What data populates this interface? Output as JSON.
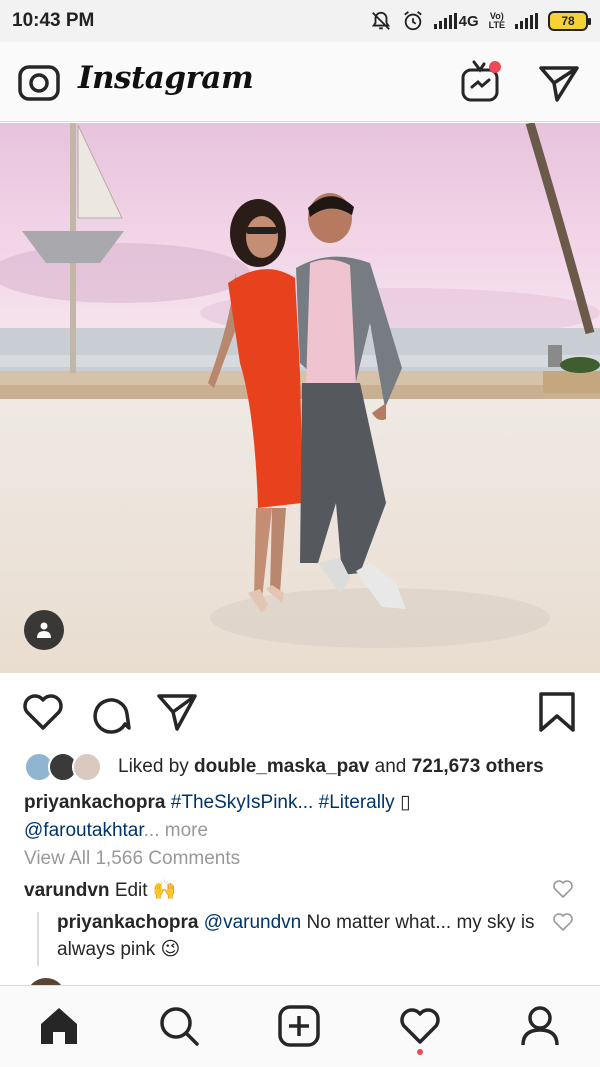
{
  "status_bar": {
    "time": "10:43 PM",
    "network": "4G",
    "volte_top": "Vo)",
    "volte_bottom": "LTE",
    "battery": "78"
  },
  "header": {
    "logo_text": "Instagram",
    "camera_icon": "camera-icon",
    "igtv_icon": "igtv-icon",
    "direct_icon": "direct-message-icon"
  },
  "post": {
    "likes_prefix": "Liked by ",
    "liked_by_user": "double_maska_pav",
    "likes_and": " and ",
    "likes_count": "721,673 others",
    "caption_user": "priyankachopra",
    "caption_hashtag1": "#TheSkyIsPink...",
    "caption_hashtag2": "#Literally",
    "caption_glyph": "▯",
    "caption_mention": "@faroutakhtar",
    "caption_ellipsis": "...",
    "caption_more": "more",
    "view_all_comments": "View All 1,566 Comments",
    "comments": [
      {
        "user": "varundvn",
        "text": "Edit 🙌"
      },
      {
        "user": "priyankachopra",
        "mention": "@varundvn",
        "text": " No matter what... my sky is always pink 😉"
      }
    ]
  },
  "bottom_nav": {
    "items": [
      "home-icon",
      "search-icon",
      "new-post-icon",
      "activity-icon",
      "profile-icon"
    ]
  },
  "colors": {
    "link": "#003569",
    "muted": "#999999",
    "notification": "#ed4956",
    "battery": "#f6d23a"
  }
}
